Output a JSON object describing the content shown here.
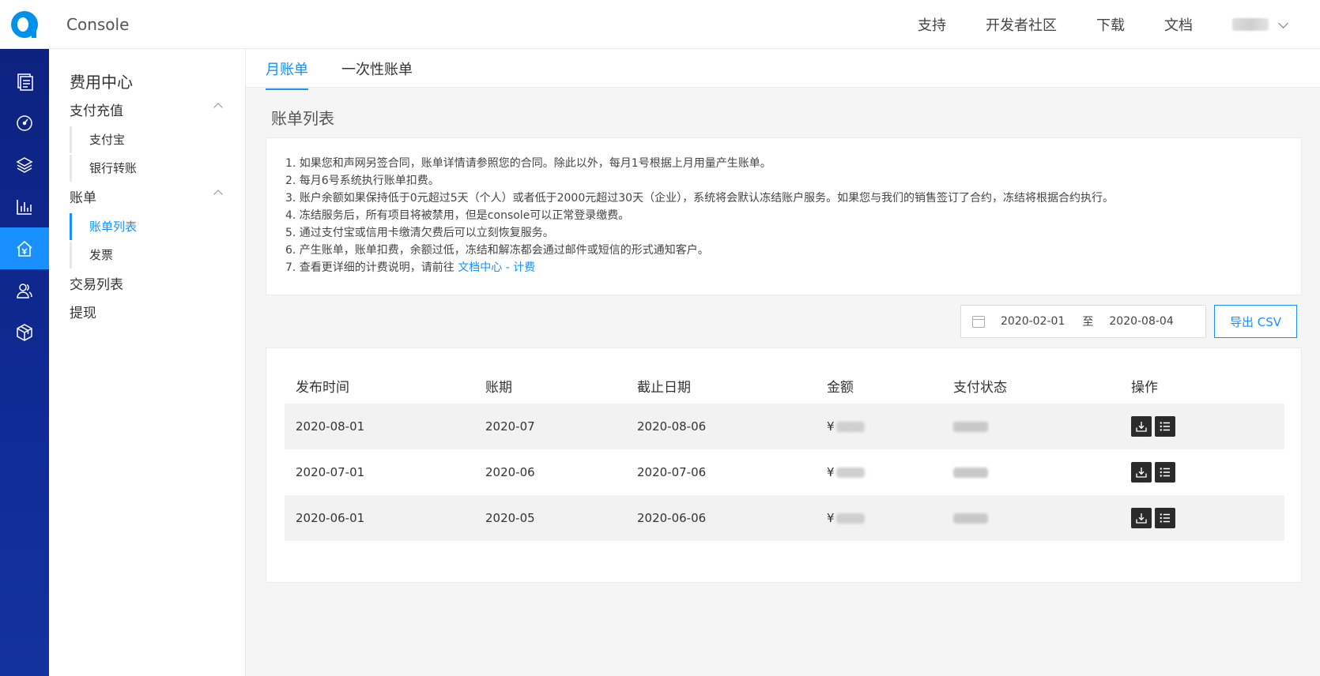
{
  "header": {
    "app_title": "Console",
    "nav": [
      "支持",
      "开发者社区",
      "下载",
      "文档"
    ]
  },
  "rail": {
    "icons": [
      "list-doc-icon",
      "dashboard-icon",
      "layers-icon",
      "bar-chart-icon",
      "billing-home-icon",
      "users-icon",
      "cube-icon"
    ],
    "active_index": 4,
    "accent": "#1890ff"
  },
  "sidebar": {
    "title": "费用中心",
    "groups": [
      {
        "label": "支付充值",
        "items": [
          "支付宝",
          "银行转账"
        ]
      },
      {
        "label": "账单",
        "items": [
          "账单列表",
          "发票"
        ]
      }
    ],
    "links": [
      "交易列表",
      "提现"
    ],
    "active_item": "账单列表"
  },
  "tabs": [
    "月账单",
    "一次性账单"
  ],
  "section_title": "账单列表",
  "notice": {
    "lines": [
      "1. 如果您和声网另签合同，账单详情请参照您的合同。除此以外，每月1号根据上月用量产生账单。",
      "2. 每月6号系统执行账单扣费。",
      "3. 账户余额如果保持低于0元超过5天（个人）或者低于2000元超过30天（企业），系统将会默认冻结账户服务。如果您与我们的销售签订了合约，冻结将根据合约执行。",
      "4. 冻结服务后，所有项目将被禁用，但是console可以正常登录缴费。",
      "5. 通过支付宝或信用卡缴清欠费后可以立刻恢复服务。",
      "6. 产生账单，账单扣费，余额过低，冻结和解冻都会通过邮件或短信的形式通知客户。"
    ],
    "last_prefix": "7. 查看更详细的计费说明，请前往 ",
    "link_text": "文档中心 - 计费"
  },
  "filter": {
    "start": "2020-02-01",
    "separator": "至",
    "end": "2020-08-04",
    "export_label": "导出 CSV"
  },
  "table": {
    "headers": [
      "发布时间",
      "账期",
      "截止日期",
      "金额",
      "支付状态",
      "操作"
    ],
    "currency": "¥",
    "rows": [
      {
        "published": "2020-08-01",
        "period": "2020-07",
        "due": "2020-08-06"
      },
      {
        "published": "2020-07-01",
        "period": "2020-06",
        "due": "2020-07-06"
      },
      {
        "published": "2020-06-01",
        "period": "2020-05",
        "due": "2020-06-06"
      }
    ],
    "action_icons": [
      "download-icon",
      "detail-list-icon"
    ]
  }
}
